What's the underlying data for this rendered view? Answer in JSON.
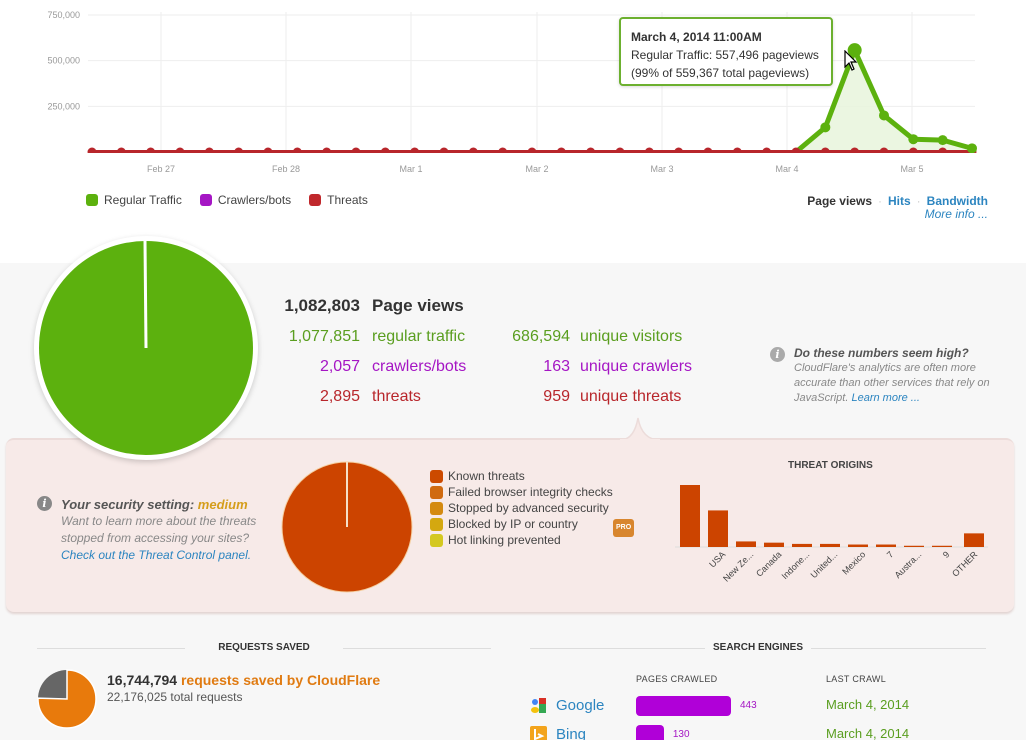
{
  "traffic_chart": {
    "chart_data": {
      "type": "line",
      "title": "",
      "y_ticks": [
        "750,000",
        "500,000",
        "250,000"
      ],
      "ylim": [
        0,
        750000
      ],
      "x_ticks": [
        "Feb 27",
        "Feb 28",
        "Mar 1",
        "Mar 2",
        "Mar 3",
        "Mar 4",
        "Mar 5"
      ],
      "grid": true,
      "series": [
        {
          "name": "Regular Traffic",
          "color": "#5cb10e",
          "values": [
            0,
            0,
            0,
            0,
            0,
            0,
            0,
            0,
            0,
            0,
            0,
            0,
            0,
            0,
            0,
            0,
            0,
            0,
            0,
            0,
            0,
            0,
            0,
            0,
            0,
            0,
            0,
            0,
            0,
            0,
            0,
            0,
            0,
            0,
            0,
            0,
            0,
            0,
            0,
            0,
            0,
            0,
            0,
            0,
            0,
            0,
            0,
            0,
            0,
            0,
            0,
            0,
            0,
            0,
            0,
            0,
            0,
            0,
            0,
            0,
            0,
            0,
            0,
            0,
            0,
            0,
            0,
            0,
            0,
            0,
            0,
            0,
            0,
            0,
            0,
            0,
            0,
            0,
            0,
            0,
            0,
            0,
            0,
            0,
            0,
            0,
            0,
            0,
            0,
            0,
            0,
            0,
            0,
            0,
            0,
            0,
            0,
            0,
            0,
            0,
            0,
            0,
            0,
            0,
            0,
            0,
            0,
            0,
            0,
            0,
            0,
            0,
            0,
            0,
            0,
            0,
            0,
            0,
            0,
            0,
            0,
            0,
            0,
            0,
            0,
            0,
            0,
            0,
            0,
            0,
            0,
            0,
            0,
            0,
            0,
            0,
            0,
            0,
            0,
            0,
            0,
            0,
            0,
            0,
            0
          ]
        },
        {
          "name": "Crawlers/bots",
          "color": "#a516c4",
          "values": []
        },
        {
          "name": "Threats",
          "color": "#b8262b",
          "values": []
        }
      ],
      "points_note": "30 points at ~5h intervals; regular traffic ~0 until Mar 4 then 135000, 557496, 200000, 70000, 65000, 20000"
    },
    "regular_values": [
      0,
      0,
      0,
      0,
      0,
      0,
      0,
      0,
      0,
      0,
      0,
      0,
      0,
      0,
      0,
      0,
      0,
      0,
      0,
      0,
      0,
      0,
      0,
      0,
      0,
      135000,
      557496,
      200000,
      70000,
      65000,
      20000
    ],
    "threat_values": [
      2000,
      2000,
      2000,
      2000,
      2000,
      2000,
      2000,
      2000,
      2000,
      2000,
      2000,
      2000,
      2000,
      2000,
      2000,
      2000,
      2000,
      2000,
      2000,
      2000,
      2000,
      2000,
      2000,
      2000,
      2000,
      2000,
      2000,
      2000,
      2000,
      2000,
      2000
    ],
    "tooltip": {
      "title": "March 4, 2014 11:00AM",
      "line1": "Regular Traffic: 557,496 pageviews",
      "line2": "(99% of 559,367 total pageviews)"
    },
    "legend": [
      {
        "label": "Regular Traffic",
        "color": "#5cb10e"
      },
      {
        "label": "Crawlers/bots",
        "color": "#a516c4"
      },
      {
        "label": "Threats",
        "color": "#c0282c"
      }
    ],
    "metric_tabs": {
      "page_views": "Page views",
      "hits": "Hits",
      "bandwidth": "Bandwidth",
      "separator": "·"
    },
    "more_info": "More info ..."
  },
  "summary": {
    "pie_colors": {
      "regular": "#5cb10e"
    },
    "total": {
      "value": "1,082,803",
      "label": "Page views"
    },
    "rows": [
      {
        "value": "1,077,851",
        "label": "regular traffic",
        "unique_value": "686,594",
        "unique_label": "unique visitors",
        "color": "green"
      },
      {
        "value": "2,057",
        "label": "crawlers/bots",
        "unique_value": "163",
        "unique_label": "unique crawlers",
        "color": "purple"
      },
      {
        "value": "2,895",
        "label": "threats",
        "unique_value": "959",
        "unique_label": "unique threats",
        "color": "red"
      }
    ],
    "note": {
      "title": "Do these numbers seem high?",
      "body": "CloudFlare's analytics are often more accurate than other services that rely on JavaScript.",
      "link": "Learn more ..."
    }
  },
  "threats": {
    "security": {
      "title_prefix": "Your security setting:",
      "level": "medium",
      "body": "Want to learn more about the threats stopped from accessing your sites?",
      "link": "Check out the Threat Control panel."
    },
    "pie_color": "#cc4400",
    "legend": [
      {
        "label": "Known threats",
        "color": "#cc4a00"
      },
      {
        "label": "Failed browser integrity checks",
        "color": "#d06a10"
      },
      {
        "label": "Stopped by advanced security",
        "color": "#d48a10"
      },
      {
        "label": "Blocked by IP or country",
        "color": "#d4a810",
        "badge": "PRO"
      },
      {
        "label": "Hot linking prevented",
        "color": "#d4c820"
      }
    ],
    "origins": {
      "chart_data": {
        "type": "bar",
        "title": "THREAT ORIGINS",
        "categories": [
          "",
          "USA",
          "New Ze...",
          "Canada",
          "Indone...",
          "United...",
          "Mexico",
          "7",
          "Austra...",
          "9",
          "OTHER"
        ],
        "values": [
          100,
          59,
          9,
          7,
          5,
          5,
          4,
          4,
          2,
          2,
          22
        ],
        "ylim": [
          0,
          100
        ],
        "color": "#cc4400"
      }
    }
  },
  "requests_saved": {
    "heading": "REQUESTS SAVED",
    "saved": "16,744,794",
    "saved_label": "requests saved by CloudFlare",
    "total": "22,176,025",
    "total_label": "total requests",
    "saved_fraction": 0.755
  },
  "search_engines": {
    "heading": "SEARCH ENGINES",
    "col_pages": "PAGES CRAWLED",
    "col_last": "LAST CRAWL",
    "rows": [
      {
        "name": "Google",
        "pages": "443",
        "pages_num": 443,
        "last": "March 4, 2014"
      },
      {
        "name": "Bing",
        "pages": "130",
        "pages_num": 130,
        "last": "March 4, 2014"
      }
    ]
  }
}
